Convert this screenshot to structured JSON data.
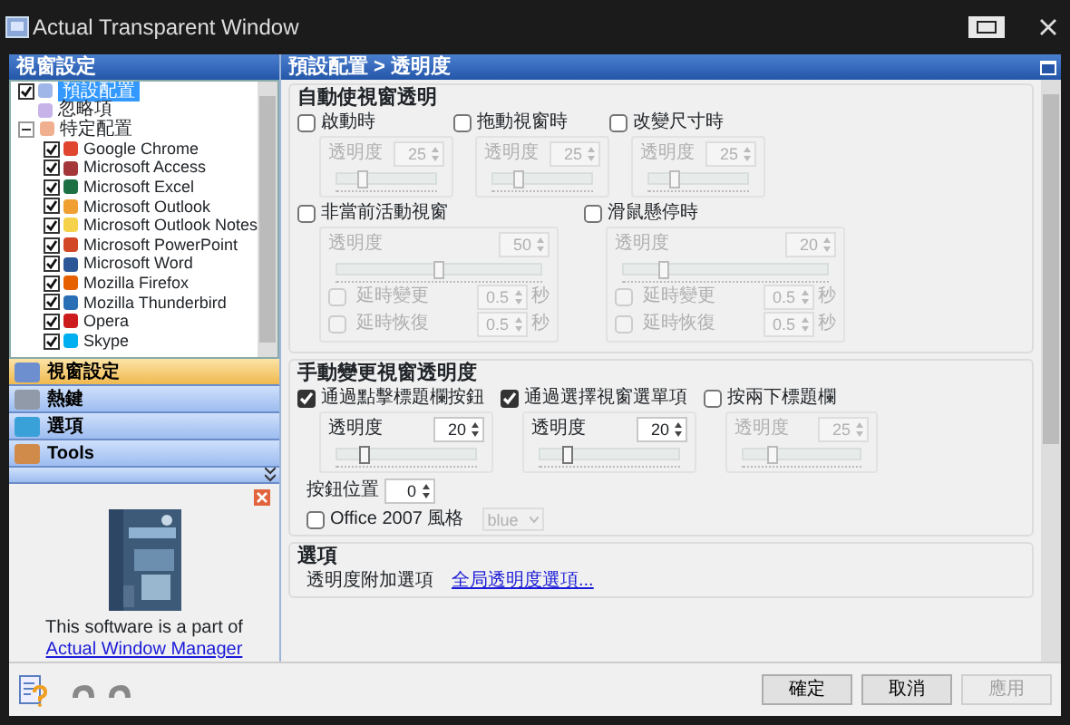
{
  "window": {
    "title": "Actual Transparent Window"
  },
  "sidebar": {
    "title": "視窗設定",
    "tree": [
      {
        "label": "預設配置",
        "kind": "preset",
        "checked": true,
        "selected": true
      },
      {
        "label": "忽略項",
        "kind": "ignore",
        "selected": false
      },
      {
        "label": "特定配置",
        "kind": "folder",
        "selected": false,
        "expanded": true,
        "children": [
          {
            "label": "Google Chrome",
            "kind": "app",
            "checked": true,
            "selected": false,
            "color": "#e0452f"
          },
          {
            "label": "Microsoft Access",
            "kind": "app",
            "checked": true,
            "selected": false,
            "color": "#a4373a"
          },
          {
            "label": "Microsoft Excel",
            "kind": "app",
            "checked": true,
            "selected": false,
            "color": "#1d7044"
          },
          {
            "label": "Microsoft Outlook",
            "kind": "app",
            "checked": true,
            "selected": false,
            "color": "#f0a030"
          },
          {
            "label": "Microsoft Outlook Notes",
            "kind": "app",
            "checked": true,
            "selected": false,
            "color": "#f5d24a"
          },
          {
            "label": "Microsoft PowerPoint",
            "kind": "app",
            "checked": true,
            "selected": false,
            "color": "#d24726"
          },
          {
            "label": "Microsoft Word",
            "kind": "app",
            "checked": true,
            "selected": false,
            "color": "#2b5797"
          },
          {
            "label": "Mozilla Firefox",
            "kind": "app",
            "checked": true,
            "selected": false,
            "color": "#e66000"
          },
          {
            "label": "Mozilla Thunderbird",
            "kind": "app",
            "checked": true,
            "selected": false,
            "color": "#2a6fb5"
          },
          {
            "label": "Opera",
            "kind": "app",
            "checked": true,
            "selected": false,
            "color": "#cc1b1b"
          },
          {
            "label": "Skype",
            "kind": "app",
            "checked": true,
            "selected": false,
            "color": "#00aff0"
          }
        ]
      }
    ]
  },
  "nav": [
    {
      "label": "視窗設定",
      "kind": "window",
      "selected": true
    },
    {
      "label": "熱鍵",
      "kind": "hotkey",
      "selected": false
    },
    {
      "label": "選項",
      "kind": "options",
      "selected": false
    },
    {
      "label": "Tools",
      "kind": "tools",
      "selected": false
    }
  ],
  "ad": {
    "text": "This software is a part of",
    "link": "Actual Window Manager"
  },
  "breadcrumb": "預設配置 > 透明度",
  "auto": {
    "title": "自動使視窗透明",
    "items": [
      {
        "kind": "basic",
        "label": "啟動時",
        "checked": false,
        "opacity_label": "透明度",
        "value": "25",
        "level": 0.25
      },
      {
        "kind": "basic",
        "label": "拖動視窗時",
        "checked": false,
        "opacity_label": "透明度",
        "value": "25",
        "level": 0.25
      },
      {
        "kind": "basic",
        "label": "改變尺寸時",
        "checked": false,
        "opacity_label": "透明度",
        "value": "25",
        "level": 0.25
      },
      {
        "kind": "delayed",
        "label": "非當前活動視窗",
        "checked": false,
        "opacity_label": "透明度",
        "value": "50",
        "level": 0.5,
        "delays": [
          {
            "label": "延時變更",
            "checked": false,
            "value": "0.5",
            "unit": "秒"
          },
          {
            "label": "延時恢復",
            "checked": false,
            "value": "0.5",
            "unit": "秒"
          }
        ]
      },
      {
        "kind": "delayed",
        "label": "滑鼠懸停時",
        "checked": false,
        "opacity_label": "透明度",
        "value": "20",
        "level": 0.2,
        "delays": [
          {
            "label": "延時變更",
            "checked": false,
            "value": "0.5",
            "unit": "秒"
          },
          {
            "label": "延時恢復",
            "checked": false,
            "value": "0.5",
            "unit": "秒"
          }
        ]
      }
    ]
  },
  "manual": {
    "title": "手動變更視窗透明度",
    "items": [
      {
        "label": "通過點擊標題欄按鈕",
        "checked": true,
        "opacity_label": "透明度",
        "value": "20",
        "level": 0.2
      },
      {
        "label": "通過選擇視窗選單項",
        "checked": true,
        "opacity_label": "透明度",
        "value": "20",
        "level": 0.2
      },
      {
        "label": "按兩下標題欄",
        "checked": false,
        "opacity_label": "透明度",
        "value": "25",
        "level": 0.25
      }
    ],
    "button_position": {
      "label": "按鈕位置",
      "value": "0"
    },
    "office_style": {
      "label": "Office 2007 風格",
      "checked": false,
      "value": "blue"
    }
  },
  "options": {
    "title": "選項",
    "label": "透明度附加選項",
    "link": "全局透明度選項..."
  },
  "buttons": [
    {
      "label": "確定",
      "disabled": false
    },
    {
      "label": "取消",
      "disabled": false
    },
    {
      "label": "應用",
      "disabled": true
    }
  ]
}
